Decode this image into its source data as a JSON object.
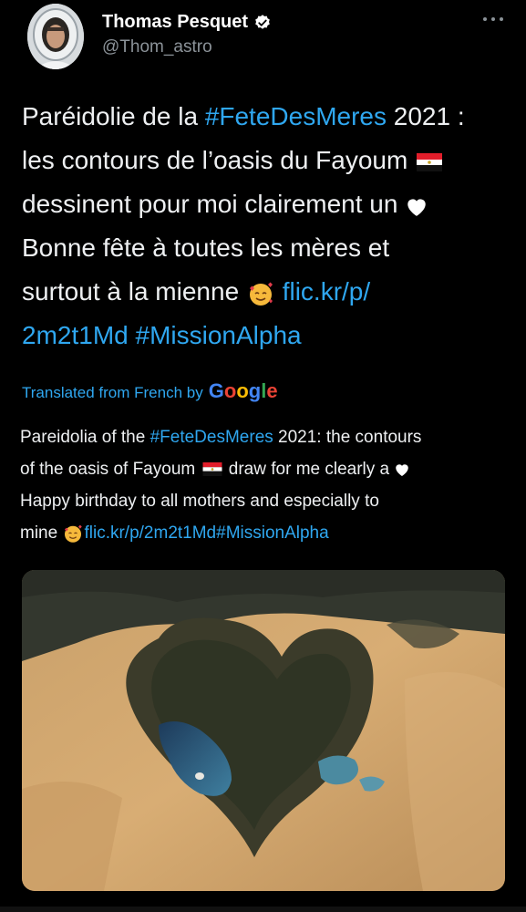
{
  "author": {
    "name": "Thomas Pesquet",
    "handle": "@Thom_astro"
  },
  "tweet": {
    "line1_text": "Paréidolie de la ",
    "line1_hashtag": "#FeteDesMeres",
    "line1_end": " 2021 :",
    "line2": "les contours de l’oasis du Fayoum",
    "line3": "dessinent pour moi clairement un",
    "line4": "Bonne fête à toutes les mères et",
    "line5_text": "surtout à la mienne",
    "line5_link": "flic.kr/p/",
    "line6_link": "2m2t1Md",
    "line6_hashtag": "#MissionAlpha"
  },
  "translation": {
    "label": "Translated from French by",
    "provider": "Google",
    "line1_text": "Pareidolia of the ",
    "line1_hashtag": "#FeteDesMeres",
    "line1_end": " 2021: the contours",
    "line2_text": "of the oasis of Fayoum",
    "line2_end": "draw for me clearly a",
    "line3": "Happy birthday to all mothers and especially to",
    "line4_text": "mine",
    "line4_link": "flic.kr/p/2m2t1Md#MissionAlpha"
  },
  "colors": {
    "background": "#000000",
    "link": "#2fa7f0",
    "secondary_text": "#8b9298"
  },
  "icons": [
    "verified-badge-icon",
    "more-options-icon",
    "egypt-flag-icon",
    "white-heart-icon",
    "smiling-face-with-hearts-icon"
  ]
}
